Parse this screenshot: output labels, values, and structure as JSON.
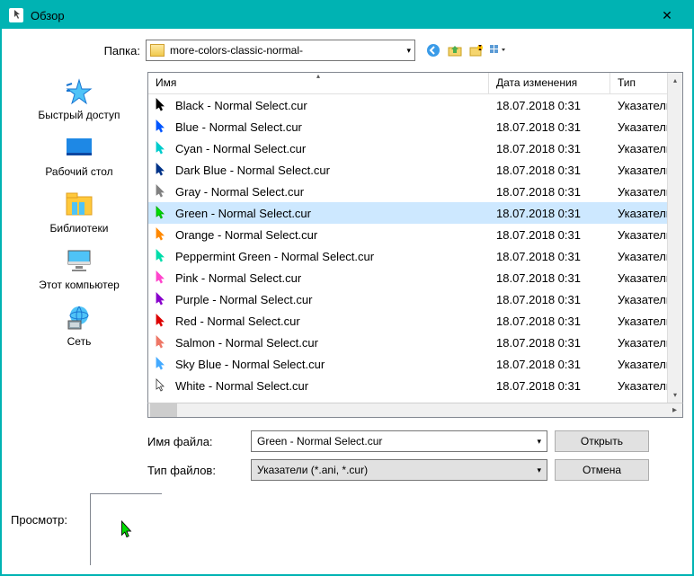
{
  "title": "Обзор",
  "folder": {
    "label": "Папка:",
    "current": "more-colors-classic-normal-"
  },
  "nav": {
    "back": "back-icon",
    "up": "up-icon",
    "newfolder": "newfolder-icon",
    "views": "views-icon"
  },
  "sidebar": [
    {
      "id": "quick-access",
      "label": "Быстрый доступ"
    },
    {
      "id": "desktop",
      "label": "Рабочий стол"
    },
    {
      "id": "libraries",
      "label": "Библиотеки"
    },
    {
      "id": "this-pc",
      "label": "Этот компьютер"
    },
    {
      "id": "network",
      "label": "Сеть"
    }
  ],
  "columns": {
    "name": "Имя",
    "date": "Дата изменения",
    "type": "Тип"
  },
  "files": [
    {
      "name": "Black - Normal Select.cur",
      "date": "18.07.2018 0:31",
      "type": "Указатель",
      "color": "#000000",
      "fill": "#000000",
      "selected": false
    },
    {
      "name": "Blue - Normal Select.cur",
      "date": "18.07.2018 0:31",
      "type": "Указатель",
      "color": "#0055ff",
      "fill": "#0055ff",
      "selected": false
    },
    {
      "name": "Cyan - Normal Select.cur",
      "date": "18.07.2018 0:31",
      "type": "Указатель",
      "color": "#00cccc",
      "fill": "#00cccc",
      "selected": false
    },
    {
      "name": "Dark Blue - Normal Select.cur",
      "date": "18.07.2018 0:31",
      "type": "Указатель",
      "color": "#003388",
      "fill": "#003388",
      "selected": false
    },
    {
      "name": "Gray - Normal Select.cur",
      "date": "18.07.2018 0:31",
      "type": "Указатель",
      "color": "#808080",
      "fill": "#808080",
      "selected": false
    },
    {
      "name": "Green - Normal Select.cur",
      "date": "18.07.2018 0:31",
      "type": "Указатель",
      "color": "#00aa00",
      "fill": "#00dd00",
      "selected": true
    },
    {
      "name": "Orange - Normal Select.cur",
      "date": "18.07.2018 0:31",
      "type": "Указатель",
      "color": "#ff8800",
      "fill": "#ff8800",
      "selected": false
    },
    {
      "name": "Peppermint Green - Normal Select.cur",
      "date": "18.07.2018 0:31",
      "type": "Указатель",
      "color": "#00ddaa",
      "fill": "#00ddaa",
      "selected": false
    },
    {
      "name": "Pink - Normal Select.cur",
      "date": "18.07.2018 0:31",
      "type": "Указатель",
      "color": "#ff44cc",
      "fill": "#ff44cc",
      "selected": false
    },
    {
      "name": "Purple - Normal Select.cur",
      "date": "18.07.2018 0:31",
      "type": "Указатель",
      "color": "#8800cc",
      "fill": "#8800cc",
      "selected": false
    },
    {
      "name": "Red - Normal Select.cur",
      "date": "18.07.2018 0:31",
      "type": "Указатель",
      "color": "#dd0000",
      "fill": "#dd0000",
      "selected": false
    },
    {
      "name": "Salmon - Normal Select.cur",
      "date": "18.07.2018 0:31",
      "type": "Указатель",
      "color": "#ee7766",
      "fill": "#ee7766",
      "selected": false
    },
    {
      "name": "Sky Blue - Normal Select.cur",
      "date": "18.07.2018 0:31",
      "type": "Указатель",
      "color": "#44aaff",
      "fill": "#44aaff",
      "selected": false
    },
    {
      "name": "White - Normal Select.cur",
      "date": "18.07.2018 0:31",
      "type": "Указатель",
      "color": "#333333",
      "fill": "#ffffff",
      "selected": false
    }
  ],
  "filename": {
    "label": "Имя файла:",
    "value": "Green - Normal Select.cur"
  },
  "filetype": {
    "label": "Тип файлов:",
    "value": "Указатели (*.ani, *.cur)"
  },
  "buttons": {
    "open": "Открыть",
    "cancel": "Отмена"
  },
  "preview": {
    "label": "Просмотр:",
    "color": "#00aa00",
    "fill": "#00dd00"
  }
}
